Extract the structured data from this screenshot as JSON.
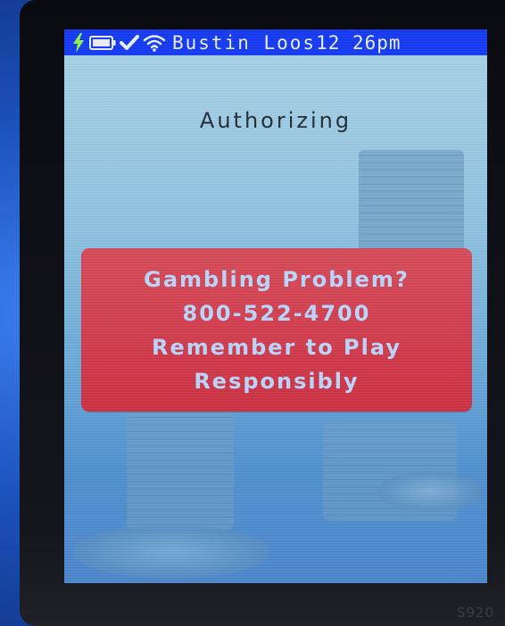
{
  "status_bar": {
    "name": "Bustin Loos",
    "time": "12 26pm",
    "icons": [
      "bolt-icon",
      "battery-icon",
      "check-icon",
      "wifi-icon"
    ]
  },
  "main": {
    "title": "Authorizing"
  },
  "banner": {
    "lines": [
      "Gambling Problem?",
      "800-522-4700",
      "Remember to Play",
      "Responsibly"
    ]
  },
  "device": {
    "model": "S920"
  },
  "colors": {
    "status_bar_bg": "#1338f2",
    "banner_bg": "#cc2f41",
    "banner_text": "#b8d6ff",
    "title_text": "#222a35"
  }
}
